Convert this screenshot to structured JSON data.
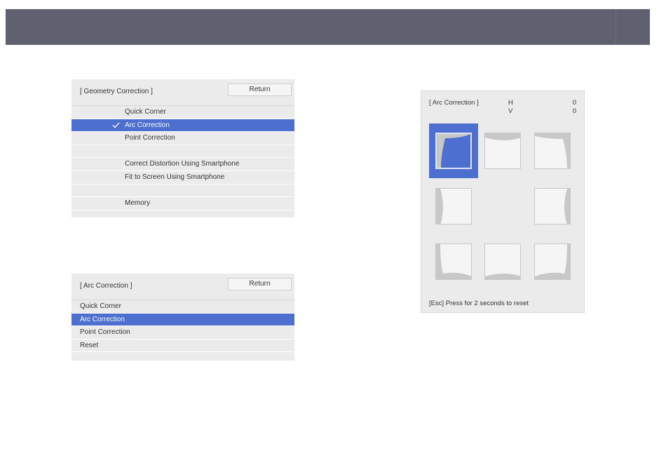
{
  "geometry_menu": {
    "title": "[ Geometry Correction ]",
    "return_label": "Return",
    "items": [
      {
        "label": "Quick Corner"
      },
      {
        "label": "Arc Correction",
        "selected": true,
        "checked": true
      },
      {
        "label": "Point Correction"
      },
      {
        "label": ""
      },
      {
        "label": "Correct Distortion Using Smartphone"
      },
      {
        "label": "Fit to Screen Using Smartphone"
      },
      {
        "label": ""
      },
      {
        "label": "Memory"
      }
    ]
  },
  "arc_menu": {
    "title": "[ Arc Correction ]",
    "return_label": "Return",
    "items": [
      {
        "label": "Quick Corner"
      },
      {
        "label": "Arc Correction",
        "selected": true
      },
      {
        "label": "Point Correction"
      },
      {
        "label": "Reset"
      }
    ]
  },
  "arc_panel": {
    "title": "[ Arc Correction ]",
    "h_label": "H",
    "h_value": "0",
    "v_label": "V",
    "v_value": "0",
    "footer": "[Esc] Press for 2 seconds to reset",
    "selected_cell": "top-left",
    "colors": {
      "accent": "#4d6fd0",
      "shape": "#c8c8c8",
      "cell_bg": "#f5f5f5"
    }
  },
  "colors": {
    "banner": "#5f6170",
    "menu_bg": "#ebebeb",
    "selected_row": "#4d6fd0"
  },
  "icons": {
    "check": "check-icon"
  }
}
